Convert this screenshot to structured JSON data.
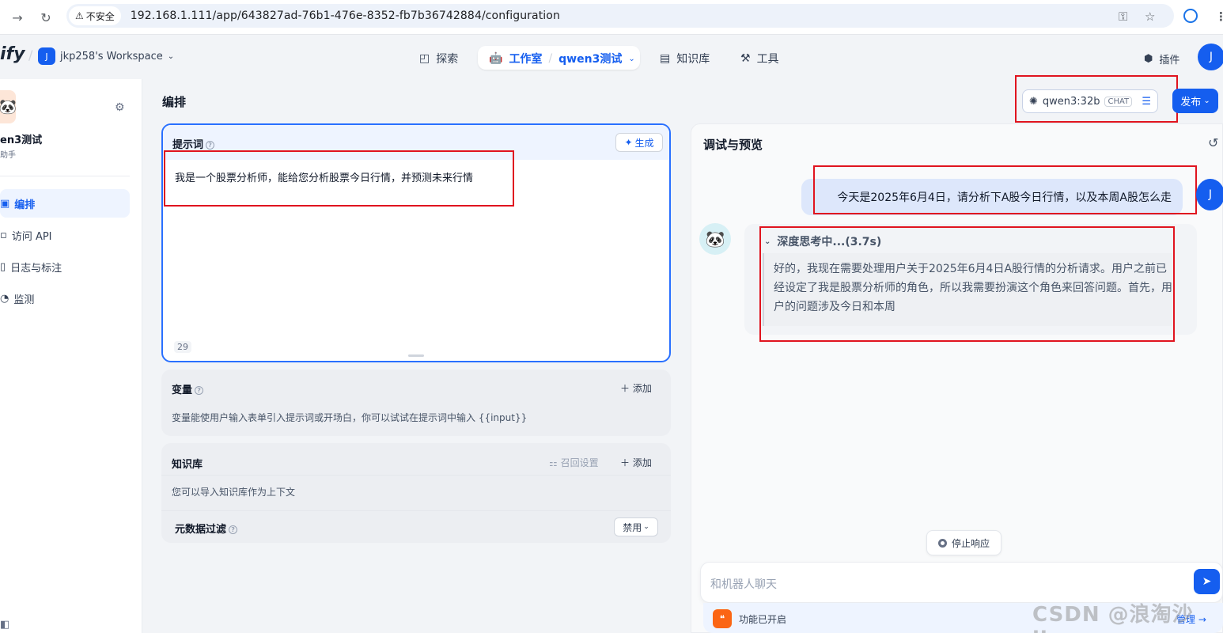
{
  "browser": {
    "security": "不安全",
    "url": "192.168.1.111/app/643827ad-76b1-476e-8352-fb7b36742884/configuration"
  },
  "header": {
    "logo": "ify",
    "workspace_initial": "J",
    "workspace": "jkp258's Workspace",
    "nav": {
      "explore": "探索",
      "studio": "工作室",
      "app": "qwen3测试",
      "knowledge": "知识库",
      "tools": "工具",
      "plugins": "插件"
    },
    "user_initial": "J"
  },
  "sidebar": {
    "app_name": "en3测试",
    "app_type": "助手",
    "items": [
      {
        "label": "编排"
      },
      {
        "label": "访问 API"
      },
      {
        "label": "日志与标注"
      },
      {
        "label": "监测"
      }
    ]
  },
  "main": {
    "title": "编排",
    "model": {
      "name": "qwen3:32b",
      "tag": "CHAT"
    },
    "publish": "发布"
  },
  "prompt": {
    "label": "提示词",
    "generate": "生成",
    "text": "我是一个股票分析师，能给您分析股票今日行情，并预测未来行情",
    "char_count": "29"
  },
  "variables": {
    "label": "变量",
    "add": "添加",
    "desc": "变量能使用户输入表单引入提示词或开场白，你可以试试在提示词中输入 {{input}}"
  },
  "knowledge": {
    "label": "知识库",
    "recall": "召回设置",
    "add": "添加",
    "desc": "您可以导入知识库作为上下文",
    "meta_filter": "元数据过滤",
    "meta_value": "禁用"
  },
  "debug": {
    "title": "调试与预览",
    "user_message": "今天是2025年6月4日，请分析下A股今日行情，以及本周A股怎么走",
    "thinking_label": "深度思考中...(3.7s)",
    "thinking_text": "好的，我现在需要处理用户关于2025年6月4日A股行情的分析请求。用户之前已经设定了我是股票分析师的角色，所以我需要扮演这个角色来回答问题。首先，用户的问题涉及今日和本周",
    "stop": "停止响应",
    "input_placeholder": "和机器人聊天",
    "features": "功能已开启",
    "manage": "管理",
    "user_initial": "J"
  },
  "watermark": "CSDN @浪淘沙jkp",
  "colors": {
    "accent": "#155eef",
    "highlight": "#e0141f"
  }
}
